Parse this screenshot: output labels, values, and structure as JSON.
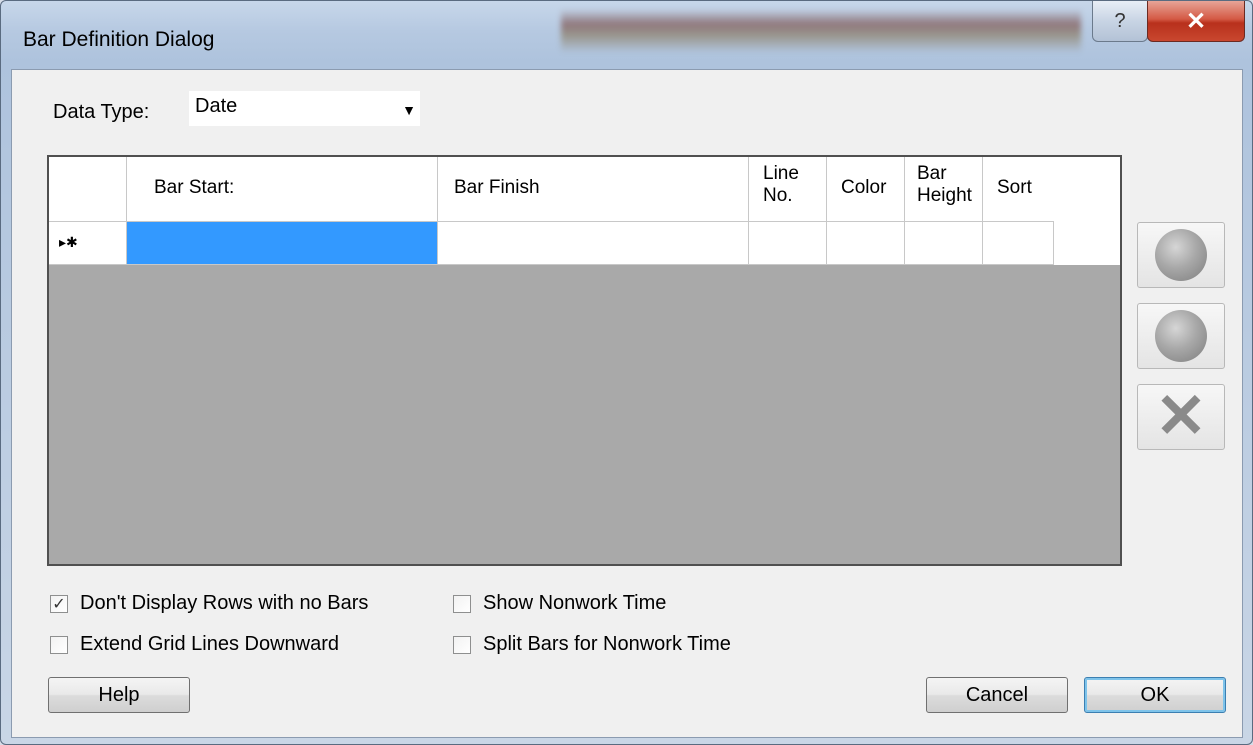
{
  "window": {
    "title": "Bar Definition Dialog",
    "help_glyph": "?",
    "close_glyph": "✕"
  },
  "data_type": {
    "label": "Data Type:",
    "value": "Date"
  },
  "grid": {
    "columns": [
      "Bar Start:",
      "Bar Finish",
      "Line\nNo.",
      "Color",
      "Bar\nHeight",
      "Sort"
    ],
    "new_row_marker": "▸✱",
    "rows": []
  },
  "side_buttons": [
    "move-up",
    "move-down",
    "delete"
  ],
  "options": {
    "dont_display_rows": {
      "label": "Don't Display Rows with no Bars",
      "checked": true
    },
    "extend_grid_lines": {
      "label": "Extend Grid Lines Downward",
      "checked": false
    },
    "show_nonwork": {
      "label": "Show Nonwork Time",
      "checked": false
    },
    "split_bars": {
      "label": "Split Bars for Nonwork Time",
      "checked": false
    },
    "check_glyph": "✓"
  },
  "buttons": {
    "help": "Help",
    "cancel": "Cancel",
    "ok": "OK"
  },
  "colors": {
    "selection": "#3399ff",
    "grid_empty": "#a9a9a9",
    "close": "#c9472f"
  }
}
